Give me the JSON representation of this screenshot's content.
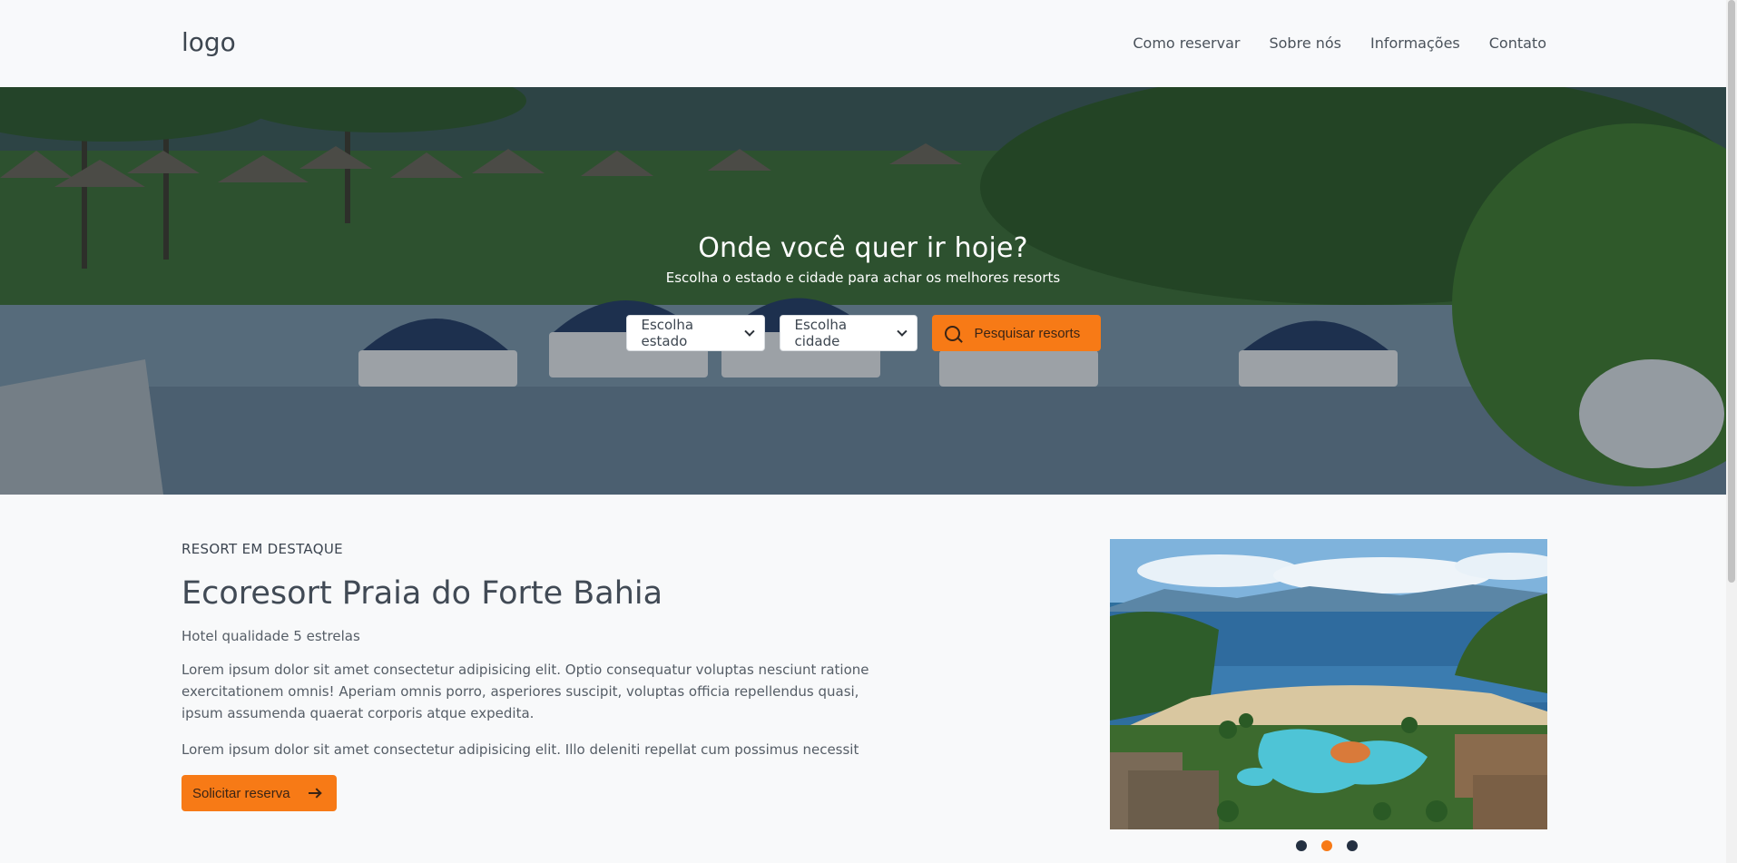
{
  "header": {
    "logo": "logo",
    "nav": [
      "Como reservar",
      "Sobre nós",
      "Informações",
      "Contato"
    ]
  },
  "hero": {
    "title": "Onde você quer ir hoje?",
    "subtitle": "Escolha o estado e cidade para achar os melhores resorts",
    "state_select": "Escolha estado",
    "city_select": "Escolha cidade",
    "search_button": "Pesquisar resorts",
    "search_icon": "search-icon"
  },
  "featured": {
    "eyebrow": "RESORT EM DESTAQUE",
    "title": "Ecoresort Praia do Forte Bahia",
    "subtitle": "Hotel qualidade 5 estrelas",
    "paragraph1": "Lorem ipsum dolor sit amet consectetur adipisicing elit. Optio consequatur voluptas nesciunt ratione exercitationem omnis! Aperiam omnis porro, asperiores suscipit, voluptas officia repellendus quasi, ipsum assumenda quaerat corporis atque expedita.",
    "paragraph2": "Lorem ipsum dolor sit amet consectetur adipisicing elit. Illo deleniti repellat cum possimus necessit",
    "reserve_button": "Solicitar reserva",
    "reserve_icon": "arrow-right-icon"
  },
  "carousel": {
    "slide_count": 3,
    "active_index": 1
  },
  "colors": {
    "accent": "#f77a16",
    "dark_dot": "#243041",
    "page_bg": "#f8f9fa"
  }
}
